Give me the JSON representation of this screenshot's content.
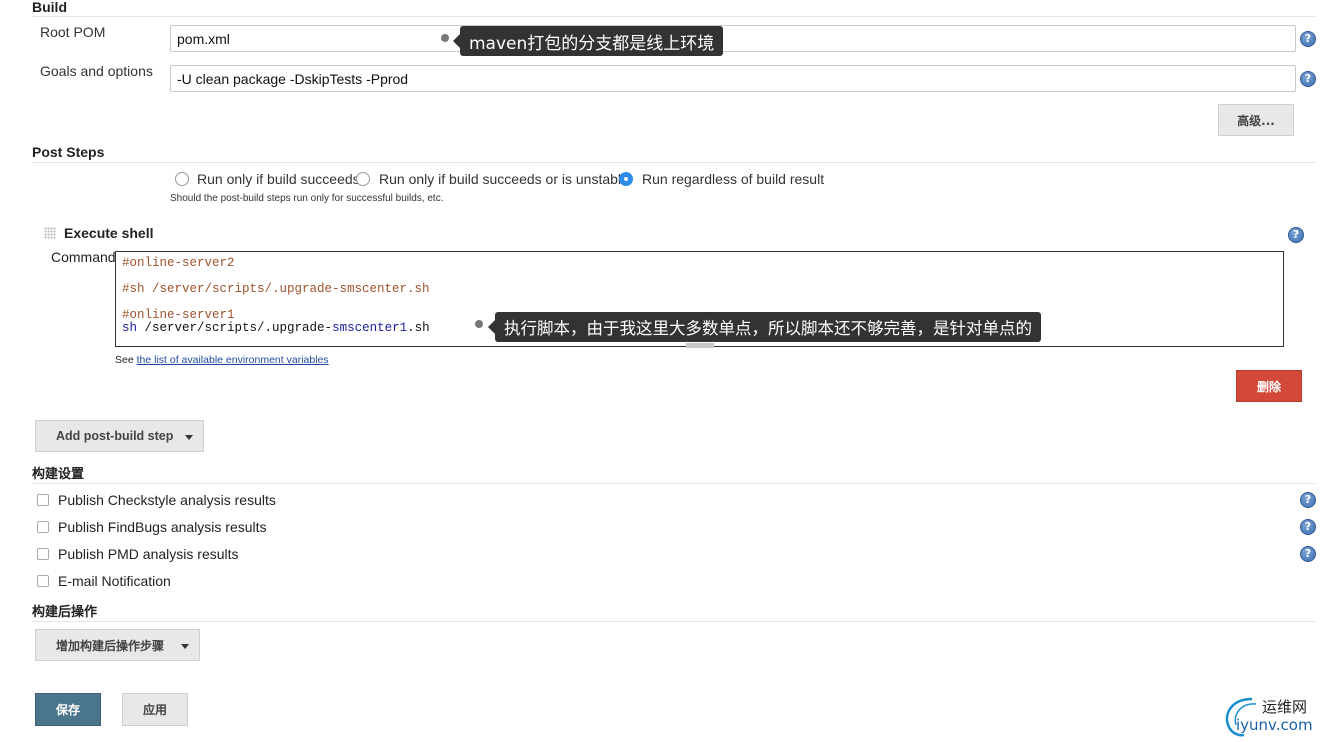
{
  "build": {
    "title": "Build",
    "root_pom_label": "Root POM",
    "root_pom_value": "pom.xml",
    "goals_label": "Goals and options",
    "goals_value": "-U clean package -DskipTests -Pprod",
    "advanced_button": "高级...",
    "tooltip_text": "maven打包的分支都是线上环境"
  },
  "post_steps": {
    "title": "Post Steps",
    "options": [
      {
        "label": "Run only if build succeeds",
        "checked": false
      },
      {
        "label": "Run only if build succeeds or is unstable",
        "checked": false
      },
      {
        "label": "Run regardless of build result",
        "checked": true
      }
    ],
    "hint": "Should the post-build steps run only for successful builds, etc."
  },
  "execute_shell": {
    "title": "Execute shell",
    "command_label": "Command",
    "lines": [
      {
        "prefix": "",
        "text": "#online-server2",
        "kind": "comment"
      },
      {
        "prefix": "",
        "text": "#sh /server/scripts/.upgrade-smscenter.sh",
        "kind": "comment"
      },
      {
        "prefix": "",
        "text": "#online-server1",
        "kind": "comment"
      },
      {
        "prefix": "sh",
        "mid": " /server/scripts/.upgrade-",
        "highlight": "smscenter1",
        "suffix": ".sh",
        "kind": "code"
      }
    ],
    "tooltip_text": "执行脚本，由于我这里大多数单点，所以脚本还不够完善，是针对单点的",
    "env_prefix": "See ",
    "env_link": "the list of available environment variables",
    "delete_button": "删除"
  },
  "add_post_build_step": "Add post-build step",
  "build_settings": {
    "title": "构建设置",
    "items": [
      {
        "label": "Publish Checkstyle analysis results",
        "help": true
      },
      {
        "label": "Publish FindBugs analysis results",
        "help": true
      },
      {
        "label": "Publish PMD analysis results",
        "help": true
      },
      {
        "label": "E-mail Notification",
        "help": false
      }
    ]
  },
  "post_build_actions": {
    "title": "构建后操作",
    "add_button": "增加构建后操作步骤"
  },
  "footer": {
    "save_button": "保存",
    "apply_button": "应用"
  },
  "watermark": {
    "line1": "运维网",
    "line2": "iyunv.com"
  },
  "colors": {
    "save_bg": "#4b758b",
    "delete_bg": "#d24939",
    "radio_checked": "#2e8bea",
    "tooltip_bg": "#333333",
    "help_icon": "#3f6fb0"
  },
  "icons": {
    "help": "question-circle-icon",
    "grip": "drag-handle-icon",
    "dropdown": "caret-down-icon"
  }
}
